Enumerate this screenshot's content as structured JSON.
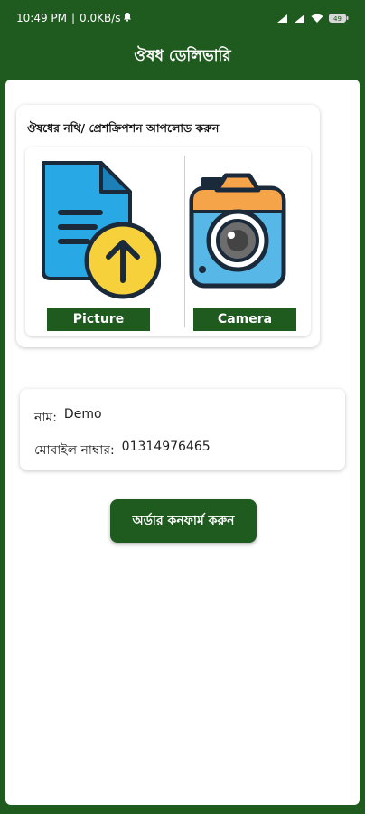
{
  "status_bar": {
    "time": "10:49 PM",
    "separator": "|",
    "network_speed": "0.0KB/s",
    "battery_level": "49",
    "icons": [
      "notification-bell-icon",
      "signal-icon",
      "signal-icon",
      "wifi-icon",
      "battery-icon"
    ]
  },
  "app_bar": {
    "title": "ঔষধ ডেলিভারি"
  },
  "upload": {
    "title": "ঔষধের নথি/ প্রেশক্রিপশন আপলোড করুন",
    "picture_label": "Picture",
    "camera_label": "Camera",
    "picture_icon": "document-upload-icon",
    "camera_icon": "camera-icon"
  },
  "info": {
    "name_label": "নাম:",
    "name_value": "Demo",
    "mobile_label": "মোবাইল নাম্বার:",
    "mobile_value": "01314976465"
  },
  "confirm_button": "অর্ডার কনফার্ম করুন",
  "colors": {
    "primary": "#1f5a1f",
    "doc_blue": "#29a8e6",
    "upload_yellow": "#f7d13c",
    "camera_orange": "#f6a44a",
    "camera_blue": "#57b7e6"
  }
}
